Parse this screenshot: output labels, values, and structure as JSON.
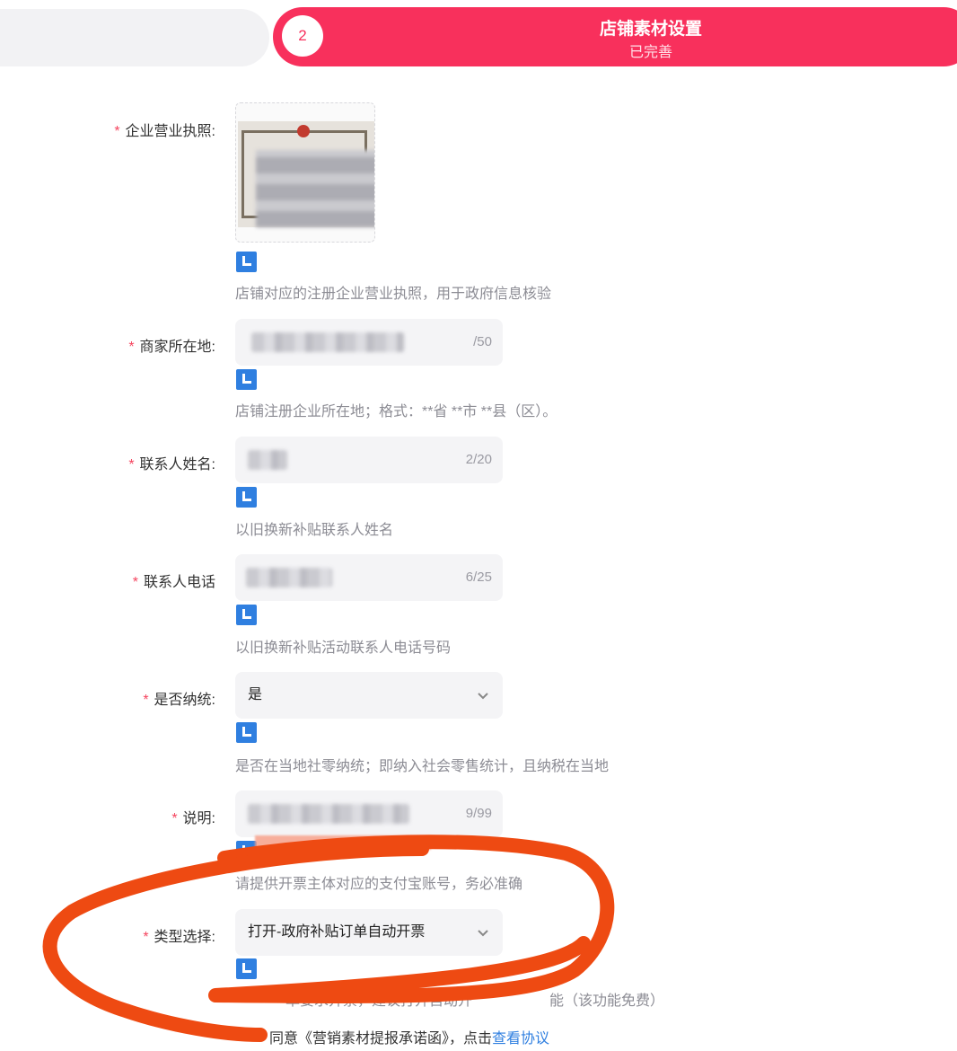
{
  "step": {
    "number": "2",
    "title": "店铺素材设置",
    "status": "已完善",
    "accent_color": "#f8305c"
  },
  "form": {
    "license": {
      "label": "企业营业执照:",
      "hint": "店铺对应的注册企业营业执照，用于政府信息核验",
      "image": "business-license-thumbnail"
    },
    "location": {
      "label": "商家所在地:",
      "value": "",
      "counter": "/50",
      "hint": "店铺注册企业所在地；格式：**省 **市 **县（区）。"
    },
    "contact_name": {
      "label": "联系人姓名:",
      "value": "",
      "counter": "2/20",
      "hint": "以旧换新补贴联系人姓名"
    },
    "contact_phone": {
      "label": "联系人电话",
      "value": "",
      "counter": "6/25",
      "hint": "以旧换新补贴活动联系人电话号码"
    },
    "tax": {
      "label": "是否纳统:",
      "value": "是",
      "hint": "是否在当地社零纳统；即纳入社会零售统计，且纳税在当地"
    },
    "note": {
      "label": "说明:",
      "value": "",
      "counter": "9/99",
      "hint": "请提供开票主体对应的支付宝账号，务必准确"
    },
    "type": {
      "label": "类型选择:",
      "value": "打开-政府补贴订单自动开票",
      "hint_left": "单要求开票，建议打开自动开",
      "hint_right": "能（该功能免费）"
    },
    "required_mark": "*"
  },
  "agreement": {
    "text": "同意《营销素材提报承诺函》，点击",
    "link": "查看协议"
  }
}
